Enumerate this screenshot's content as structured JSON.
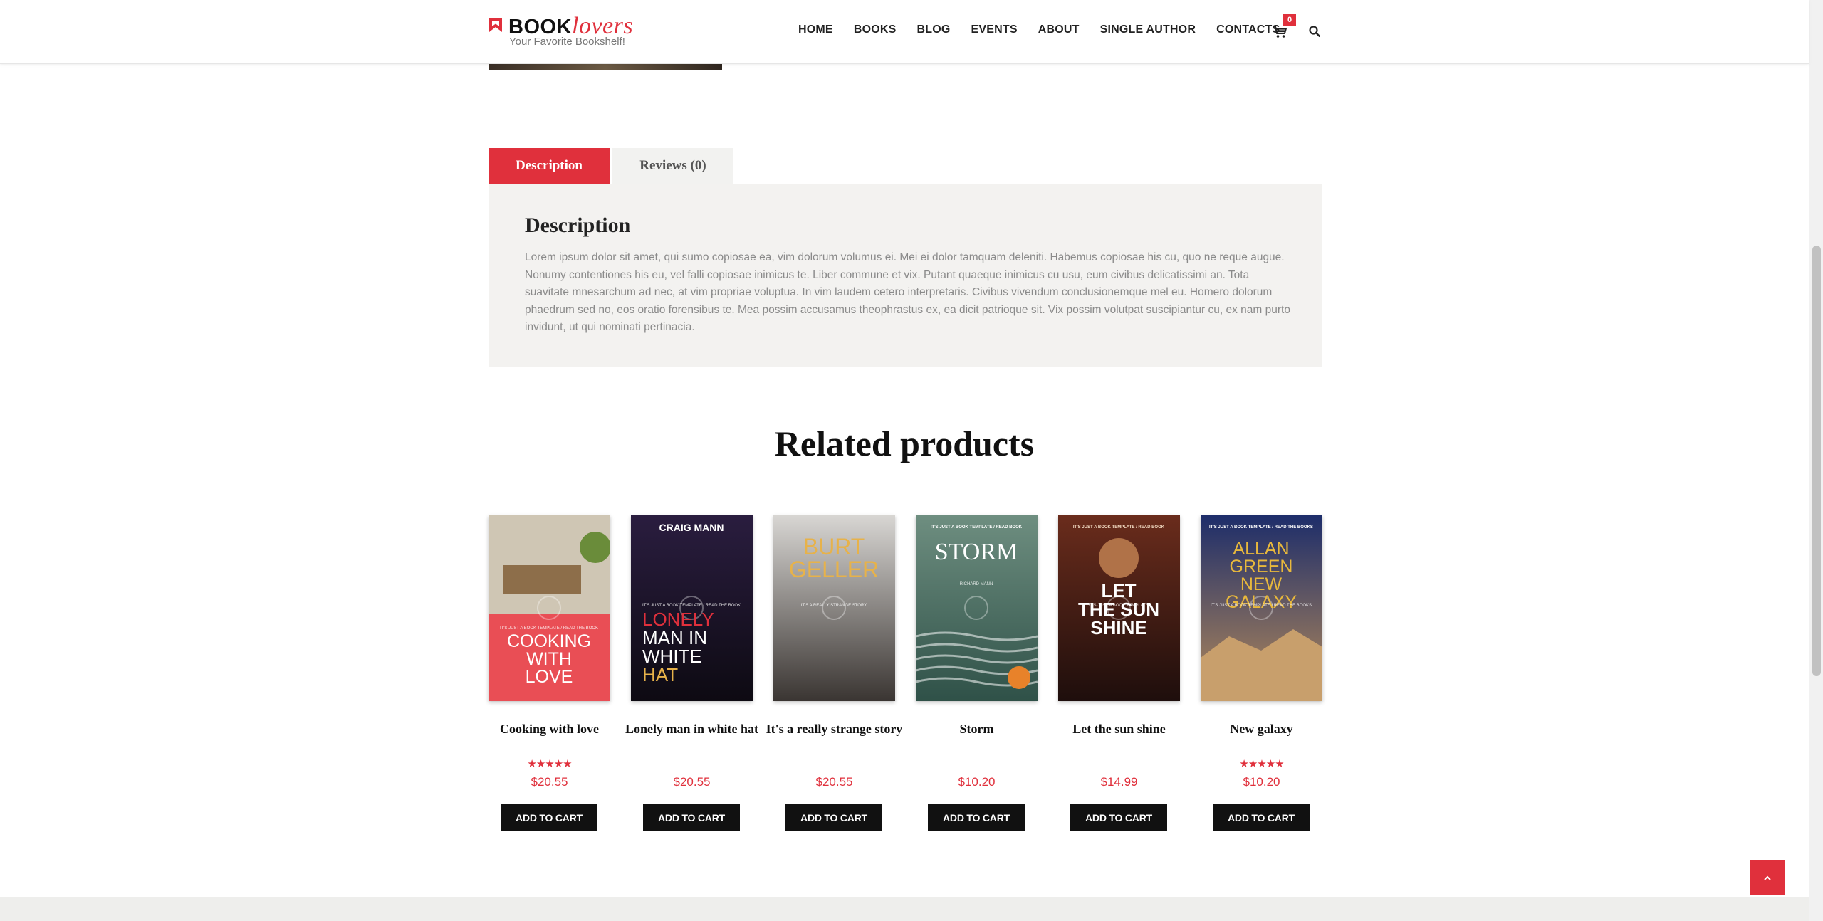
{
  "header": {
    "logo_book": "BOOK",
    "logo_lovers": "lovers",
    "tagline": "Your Favorite Bookshelf!",
    "nav": [
      "HOME",
      "BOOKS",
      "BLOG",
      "EVENTS",
      "ABOUT",
      "SINGLE AUTHOR",
      "CONTACTS"
    ],
    "cart_count": "0"
  },
  "tabs": {
    "description": "Description",
    "reviews": "Reviews (0)"
  },
  "description": {
    "title": "Description",
    "text": "Lorem ipsum dolor sit amet, qui sumo copiosae ea, vim dolorum volumus ei. Mei ei dolor tamquam deleniti. Habemus copiosae his cu, quo ne reque augue. Nonumy contentiones his eu, vel falli copiosae inimicus te. Liber commune et vix. Putant quaeque inimicus cu usu, eum civibus delicatissimi an. Tota suavitate mnesarchum ad nec, at vim propriae voluptua. In vim laudem cetero interpretaris. Civibus vivendum conclusionemque mel eu. Homero dolorum phaedrum sed no, eos oratio forensibus te. Mea possim accusamus theophrastus ex, ea dicit patrioque sit. Vix possim volutpat suscipiantur cu, ex nam purto invidunt, ut qui nominati pertinacia."
  },
  "related": {
    "title": "Related products",
    "button_label": "ADD TO CART",
    "products": [
      {
        "name": "Cooking with love",
        "price": "$20.55",
        "rated": true,
        "rating": 5,
        "cover": {
          "lines": [
            "COOKING",
            "WITH",
            "LOVE"
          ],
          "top_text": "",
          "small": "IT'S JUST A BOOK TEMPLATE / READ THE BOOK"
        }
      },
      {
        "name": "Lonely man in white hat",
        "price": "$20.55",
        "rated": false,
        "rating": 0,
        "cover": {
          "lines": [
            "LONELY",
            "MAN IN",
            "WHITE",
            "HAT"
          ],
          "top_text": "CRAIG MANN",
          "small": "IT'S JUST A BOOK TEMPLATE / READ THE BOOK"
        }
      },
      {
        "name": "It's a really strange story",
        "price": "$20.55",
        "rated": false,
        "rating": 0,
        "cover": {
          "lines": [
            "BURT",
            "GELLER"
          ],
          "top_text": "",
          "small": "IT'S A REALLY STRANGE STORY"
        }
      },
      {
        "name": "Storm",
        "price": "$10.20",
        "rated": false,
        "rating": 0,
        "cover": {
          "lines": [
            "STORM"
          ],
          "top_text": "IT'S JUST A BOOK TEMPLATE / READ BOOK",
          "small": "RICHARD MANN"
        }
      },
      {
        "name": "Let the sun shine",
        "price": "$14.99",
        "rated": false,
        "rating": 0,
        "cover": {
          "lines": [
            "LET",
            "THE SUN",
            "SHINE"
          ],
          "top_text": "IT'S JUST A BOOK TEMPLATE / READ BOOK",
          "small": "IT'S JUST A BOOK TEMPLATE"
        }
      },
      {
        "name": "New galaxy",
        "price": "$10.20",
        "rated": true,
        "rating": 5,
        "cover": {
          "lines": [
            "ALLAN",
            "GREEN",
            "NEW",
            "GALAXY"
          ],
          "top_text": "IT'S JUST A BOOK TEMPLATE / READ THE BOOKS",
          "small": "IT'S JUST A BOOK TEMPLATE / READ THE BOOKS"
        }
      }
    ]
  },
  "colors": {
    "accent": "#e0303c",
    "dark": "#111111",
    "panel": "#f3f2f0"
  }
}
